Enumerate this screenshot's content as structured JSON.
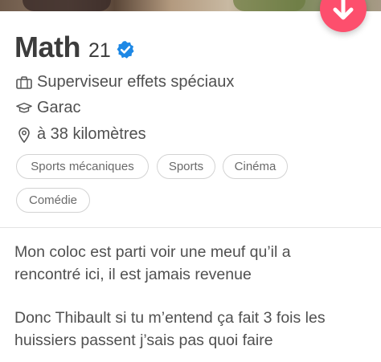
{
  "profile": {
    "name": "Math",
    "age": "21",
    "job": "Superviseur effets spéciaux",
    "school": "Garac",
    "distance": "à 38 kilomètres"
  },
  "interests": [
    "Sports mécaniques",
    "Sports",
    "Cinéma",
    "Comédie"
  ],
  "bio": {
    "paragraph1": "Mon coloc est parti voir une meuf qu’il a\nrencontré ici, il est jamais revenue",
    "paragraph2": "Donc Thibault si tu m’entend ça fait 3 fois les\nhuissiers passent j’sais pas quoi faire"
  },
  "colors": {
    "accent": "#fd4f6d",
    "verified": "#1e88e5",
    "text": "#424242"
  },
  "icons": {
    "collapse": "arrow-down-icon",
    "verified": "verified-badge-icon",
    "job": "briefcase-icon",
    "school": "graduation-cap-icon",
    "distance": "location-pin-icon"
  }
}
